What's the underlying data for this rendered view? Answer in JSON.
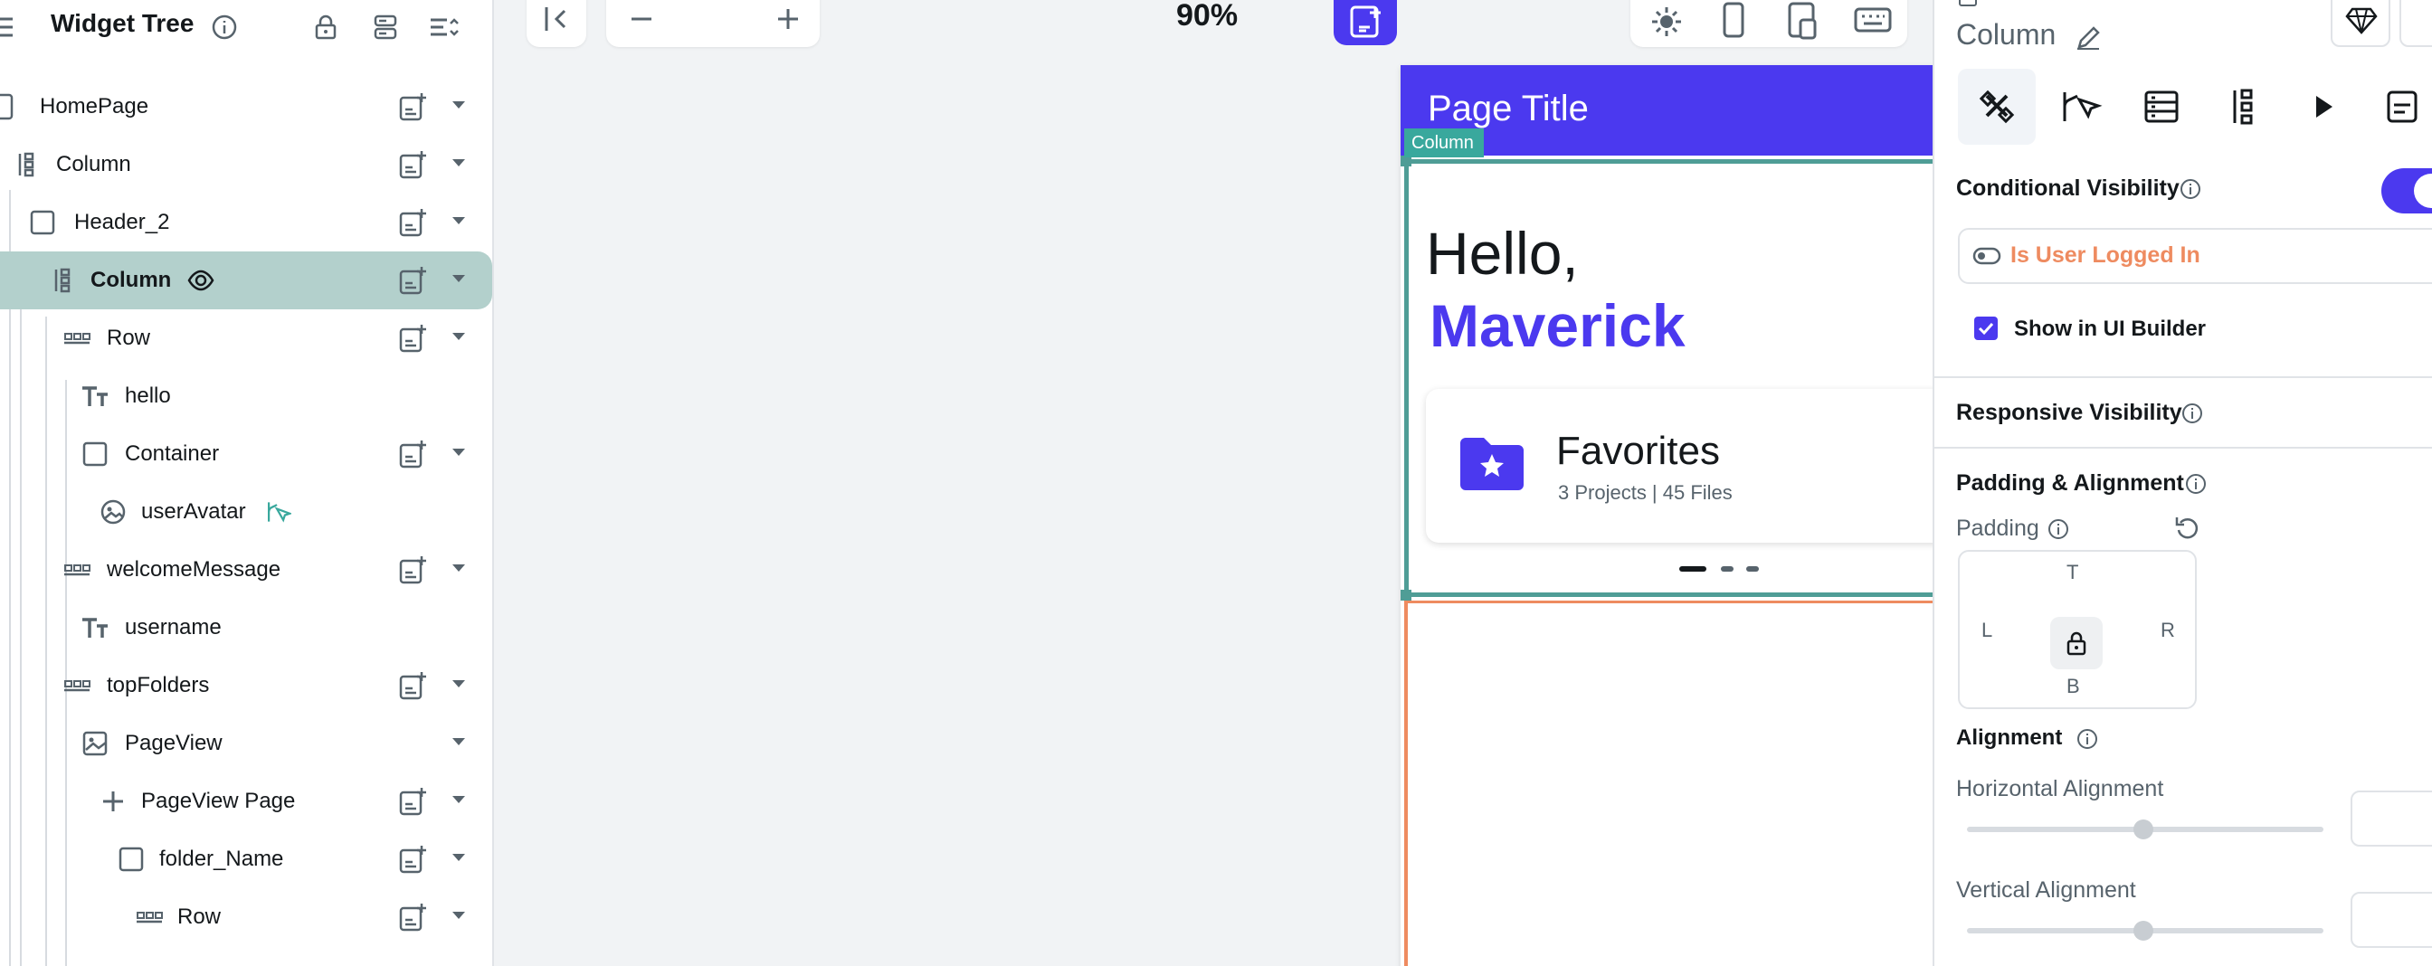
{
  "left_panel": {
    "title": "Widget Tree",
    "tree": [
      {
        "label": "HomePage",
        "icon": "phone-icon"
      },
      {
        "label": "Column",
        "icon": "column-icon"
      },
      {
        "label": "Header_2",
        "icon": "container-icon"
      },
      {
        "label": "Column",
        "icon": "column-icon",
        "selected": true
      },
      {
        "label": "Row",
        "icon": "row-icon"
      },
      {
        "label": "hello",
        "icon": "text-icon"
      },
      {
        "label": "Container",
        "icon": "container-icon"
      },
      {
        "label": "userAvatar",
        "icon": "image-circle-icon"
      },
      {
        "label": "welcomeMessage",
        "icon": "row-icon"
      },
      {
        "label": "username",
        "icon": "text-icon"
      },
      {
        "label": "topFolders",
        "icon": "row-icon"
      },
      {
        "label": "PageView",
        "icon": "pageview-icon"
      },
      {
        "label": "PageView Page",
        "icon": "plus-icon"
      },
      {
        "label": "folder_Name",
        "icon": "container-icon"
      },
      {
        "label": "Row",
        "icon": "row-icon"
      }
    ]
  },
  "toolbar": {
    "zoom": "90%"
  },
  "preview": {
    "page_title": "Page Title",
    "selection_tag": "Column",
    "greeting": "Hello,",
    "username": "Maverick",
    "card_title": "Favorites",
    "card_subtitle": "3 Projects | 45 Files",
    "accent_color": "#4b39ef"
  },
  "right_panel": {
    "widget_name": "Column",
    "conditional_visibility": "Conditional Visibility",
    "condition": "Is User Logged In",
    "show_in_builder": "Show in UI Builder",
    "responsive_visibility": "Responsive Visibility",
    "padding_alignment": "Padding & Alignment",
    "padding": "Padding",
    "pad_t": "T",
    "pad_l": "L",
    "pad_r": "R",
    "pad_b": "B",
    "alignment": "Alignment",
    "horizontal_alignment": "Horizontal Alignment",
    "vertical_alignment": "Vertical Alignment"
  }
}
